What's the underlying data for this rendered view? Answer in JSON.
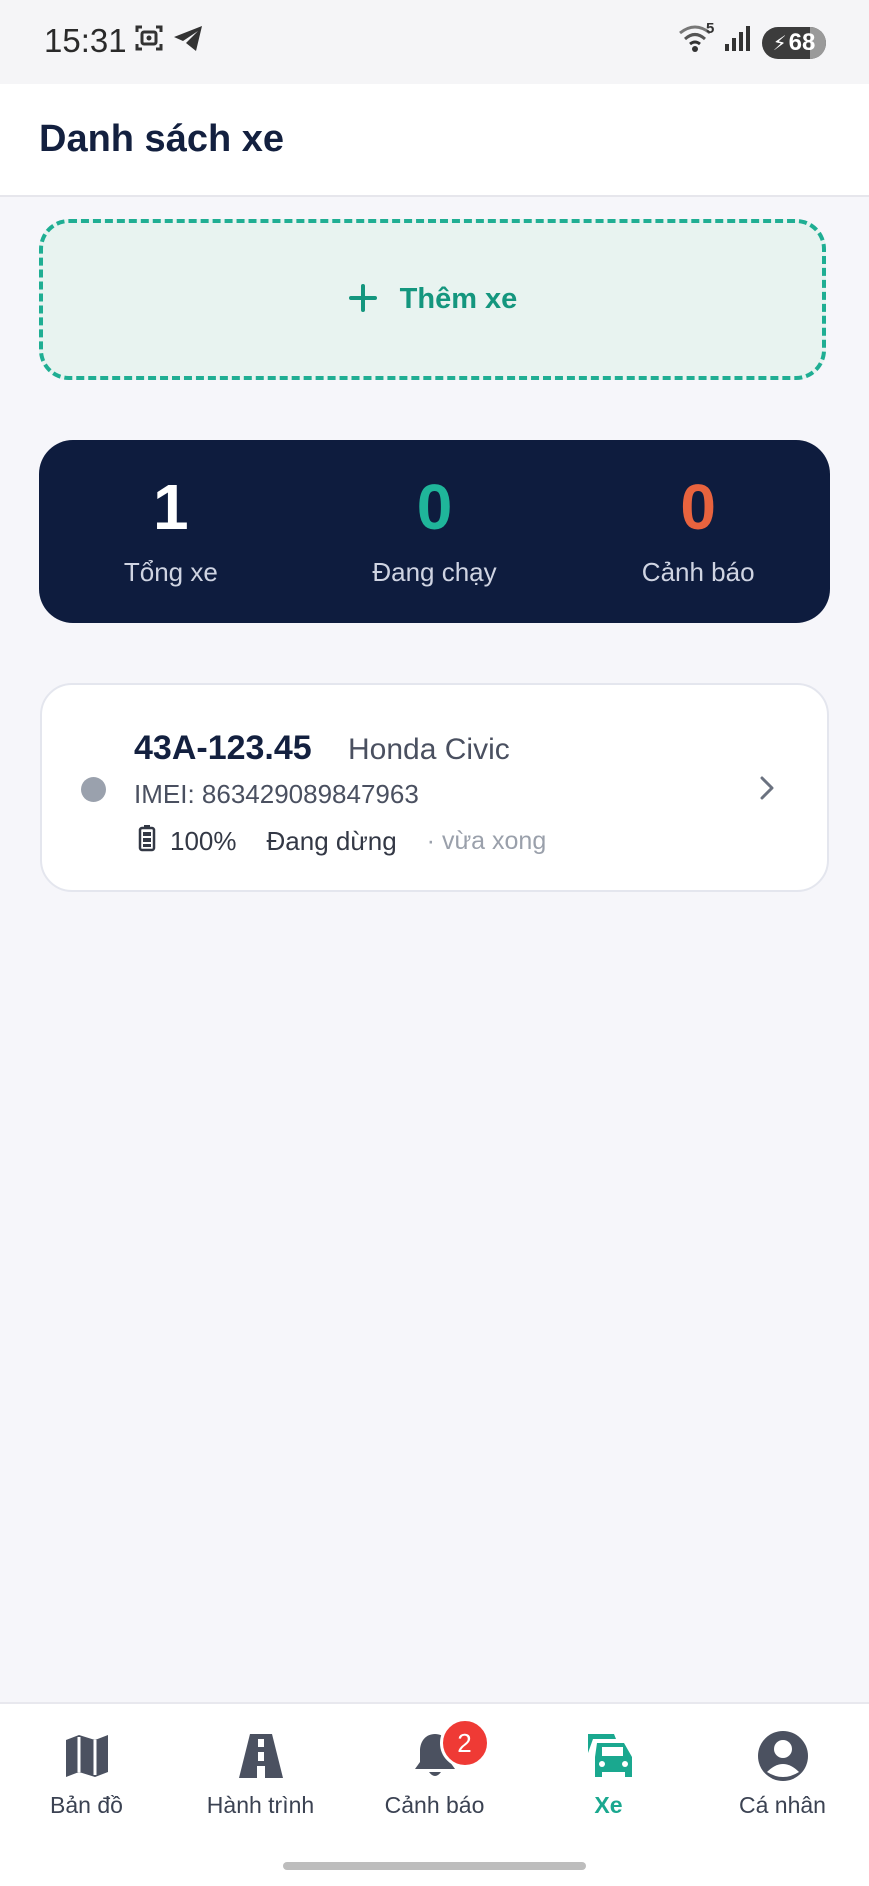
{
  "status_bar": {
    "time": "15:31",
    "network": "5",
    "battery_level": "68",
    "icons": [
      "screenshot-icon",
      "telegram-icon",
      "wifi-icon",
      "signal-icon",
      "battery-charging-icon"
    ]
  },
  "header": {
    "title": "Danh sách xe"
  },
  "add_button": {
    "label": "Thêm xe",
    "icon": "plus-icon",
    "accent": "#1aa88f"
  },
  "stats": [
    {
      "value": "1",
      "caption": "Tổng xe",
      "color": "#ffffff"
    },
    {
      "value": "0",
      "caption": "Đang chạy",
      "color": "#1fb59a"
    },
    {
      "value": "0",
      "caption": "Cảnh báo",
      "color": "#e8633e"
    }
  ],
  "vehicles": [
    {
      "plate": "43A-123.45",
      "model": "Honda Civic",
      "imei": "IMEI: 863429089847963",
      "battery": "100%",
      "state": "Đang dừng",
      "updated": "· vừa xong",
      "status_color": "#9aa1ad"
    }
  ],
  "bottom_nav": {
    "active_color": "#1aa88f",
    "items": [
      {
        "label": "Bản đồ",
        "icon": "map-icon"
      },
      {
        "label": "Hành trình",
        "icon": "road-icon"
      },
      {
        "label": "Cảnh báo",
        "icon": "bell-icon",
        "badge": "2"
      },
      {
        "label": "Xe",
        "icon": "car-icon",
        "active": true
      },
      {
        "label": "Cá nhân",
        "icon": "user-icon"
      }
    ]
  }
}
